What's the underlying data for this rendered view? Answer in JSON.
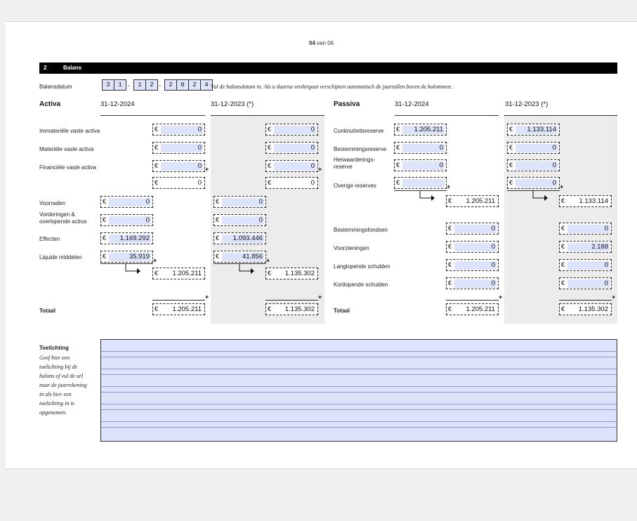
{
  "page_number": {
    "current": "04",
    "of": "van 06"
  },
  "section": {
    "number": "2",
    "title": "Balans"
  },
  "balance_date": {
    "label": "Balansdatum",
    "day": [
      "3",
      "1"
    ],
    "month": [
      "1",
      "2"
    ],
    "year": [
      "2",
      "0",
      "2",
      "4"
    ],
    "separator": "-",
    "instruction": "Vul de balansdatum in. Als u daarna verdergaat verschijnen automatisch de jaartallen boven de kolommen."
  },
  "currency": "€",
  "activa": {
    "title": "Activa",
    "col1": "31-12-2024",
    "col2": "31-12-2023 (*)",
    "rows": {
      "immaterieel": {
        "label": "Immateriële vaste activa",
        "v1": "0",
        "v2": "0"
      },
      "materieel": {
        "label": "Materiële vaste activa",
        "v1": "0",
        "v2": "0"
      },
      "financieel": {
        "label": "Financiële vaste activa",
        "v1": "0",
        "v2": "0"
      },
      "vaste_subtotal": {
        "v1": "0",
        "v2": "0"
      },
      "voorraden": {
        "label": "Voorraden",
        "v1": "0",
        "v2": "0"
      },
      "vorderingen": {
        "label": "Vorderingen & overlopende activa",
        "v1": "0",
        "v2": "0"
      },
      "effecten": {
        "label": "Effecten",
        "v1": "1.169.292",
        "v2": "1.093.446"
      },
      "liquide": {
        "label": "Liquide middelen",
        "v1": "35.919",
        "v2": "41.856"
      },
      "vlottend_subtotal": {
        "v1": "1.205.211",
        "v2": "1.135.302"
      },
      "totaal": {
        "label": "Totaal",
        "v1": "1.205.211",
        "v2": "1.135.302"
      }
    }
  },
  "passiva": {
    "title": "Passiva",
    "col1": "31-12-2024",
    "col2": "31-12-2023 (*)",
    "rows": {
      "continuiteit": {
        "label": "Continuïteitsreserve",
        "v1": "1.205.211",
        "v2": "1.133.114"
      },
      "bestemming": {
        "label": "Bestemmingsreserve",
        "v1": "0",
        "v2": "0"
      },
      "herwaardering": {
        "label": "Herwaarderings-reserve",
        "v1": "0",
        "v2": "0"
      },
      "overige": {
        "label": "Overige reserves",
        "v1": "",
        "v2": "0"
      },
      "reserves_subtotal": {
        "v1": "1.205.211",
        "v2": "1.133.114"
      },
      "fondsen": {
        "label": "Bestemmingsfondsen",
        "v1": "0",
        "v2": "0"
      },
      "voorzieningen": {
        "label": "Voorzieningen",
        "v1": "0",
        "v2": "2.188"
      },
      "langlopend": {
        "label": "Langlopende schulden",
        "v1": "0",
        "v2": "0"
      },
      "kortlopend": {
        "label": "Kortlopende schulden",
        "v1": "0",
        "v2": "0"
      },
      "totaal": {
        "label": "Totaal",
        "v1": "1.205.211",
        "v2": "1.135.302"
      }
    }
  },
  "toelichting": {
    "title": "Toelichting",
    "help": "Geef hier een toelichting bij de balans of vul de url naar de jaarrekening in als hier een toelichting in is opgenomen.",
    "value": ""
  },
  "symbols": {
    "plus": "+"
  }
}
